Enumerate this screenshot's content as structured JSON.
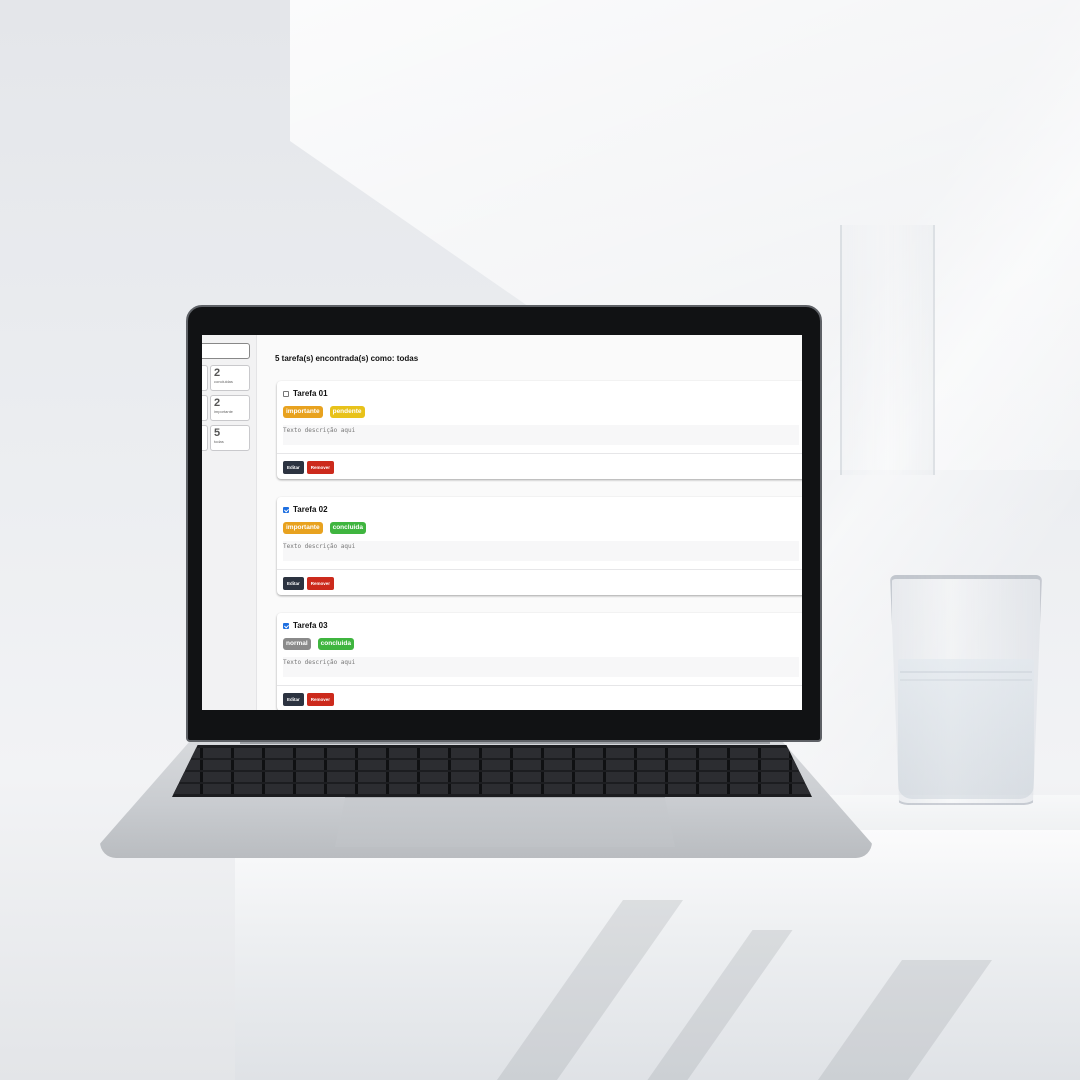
{
  "sidebar": {
    "stats": [
      {
        "number": "2",
        "label": "concluidas"
      },
      {
        "number": "2",
        "label": "importante"
      },
      {
        "number": "5",
        "label": "todas"
      }
    ]
  },
  "main": {
    "summary": "5 tarefa(s) encontrada(s) como: todas",
    "tasks": [
      {
        "title": "Tarefa 01",
        "checked": false,
        "tags": [
          {
            "text": "importante",
            "color": "#e8a21f"
          },
          {
            "text": "pendente",
            "color": "#e8c21a"
          }
        ],
        "description": "Texto descrição aqui"
      },
      {
        "title": "Tarefa 02",
        "checked": true,
        "tags": [
          {
            "text": "importante",
            "color": "#e8a21f"
          },
          {
            "text": "concluida",
            "color": "#3fb53f"
          }
        ],
        "description": "Texto descrição aqui"
      },
      {
        "title": "Tarefa 03",
        "checked": true,
        "tags": [
          {
            "text": "normal",
            "color": "#8a8a8a"
          },
          {
            "text": "concluida",
            "color": "#3fb53f"
          }
        ],
        "description": "Texto descrição aqui"
      }
    ],
    "edit_label": "Editar",
    "remove_label": "Remover"
  }
}
